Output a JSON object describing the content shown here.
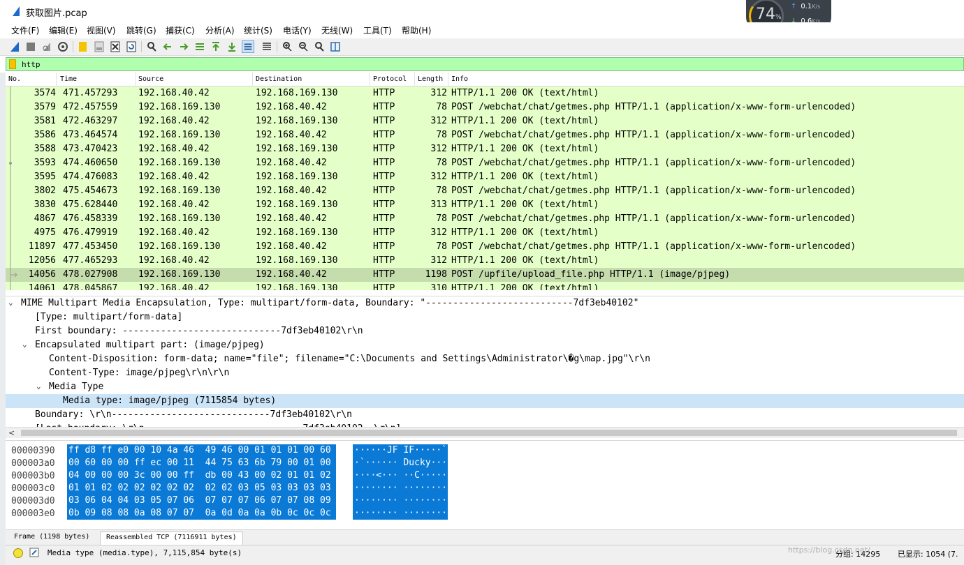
{
  "window": {
    "title": "获取图片.pcap"
  },
  "widget": {
    "cpu_percent": "74",
    "percent_sign": "%",
    "upload": "0.1",
    "download": "0.6",
    "unit": "K/s"
  },
  "menu": [
    "文件(F)",
    "编辑(E)",
    "视图(V)",
    "跳转(G)",
    "捕获(C)",
    "分析(A)",
    "统计(S)",
    "电话(Y)",
    "无线(W)",
    "工具(T)",
    "帮助(H)"
  ],
  "toolbar": [
    "shark-fin-start-icon",
    "stop-square-icon",
    "restart-fin-icon",
    "capture-options-gear-icon",
    "open-folder-icon",
    "file-save-icon",
    "file-close-icon",
    "reload-icon",
    "find-icon",
    "go-back-icon",
    "go-forward-icon",
    "go-to-packet-icon",
    "go-first-icon",
    "go-last-icon",
    "auto-scroll-icon",
    "colorize-icon",
    "zoom-in-icon",
    "zoom-out-icon",
    "zoom-normal-icon",
    "resize-columns-icon"
  ],
  "filter": {
    "value": "http"
  },
  "packet_list": {
    "columns": [
      "No.",
      "Time",
      "Source",
      "Destination",
      "Protocol",
      "Length",
      "Info"
    ],
    "rows": [
      {
        "no": "3574",
        "time": "471.457293",
        "src": "192.168.40.42",
        "dst": "192.168.169.130",
        "proto": "HTTP",
        "len": "312",
        "info": "HTTP/1.1 200 OK  (text/html)"
      },
      {
        "no": "3579",
        "time": "472.457559",
        "src": "192.168.169.130",
        "dst": "192.168.40.42",
        "proto": "HTTP",
        "len": "78",
        "info": "POST /webchat/chat/getmes.php HTTP/1.1  (application/x-www-form-urlencoded)"
      },
      {
        "no": "3581",
        "time": "472.463297",
        "src": "192.168.40.42",
        "dst": "192.168.169.130",
        "proto": "HTTP",
        "len": "312",
        "info": "HTTP/1.1 200 OK  (text/html)"
      },
      {
        "no": "3586",
        "time": "473.464574",
        "src": "192.168.169.130",
        "dst": "192.168.40.42",
        "proto": "HTTP",
        "len": "78",
        "info": "POST /webchat/chat/getmes.php HTTP/1.1  (application/x-www-form-urlencoded)"
      },
      {
        "no": "3588",
        "time": "473.470423",
        "src": "192.168.40.42",
        "dst": "192.168.169.130",
        "proto": "HTTP",
        "len": "312",
        "info": "HTTP/1.1 200 OK  (text/html)"
      },
      {
        "no": "3593",
        "time": "474.460650",
        "src": "192.168.169.130",
        "dst": "192.168.40.42",
        "proto": "HTTP",
        "len": "78",
        "info": "POST /webchat/chat/getmes.php HTTP/1.1  (application/x-www-form-urlencoded)"
      },
      {
        "no": "3595",
        "time": "474.476083",
        "src": "192.168.40.42",
        "dst": "192.168.169.130",
        "proto": "HTTP",
        "len": "312",
        "info": "HTTP/1.1 200 OK  (text/html)"
      },
      {
        "no": "3802",
        "time": "475.454673",
        "src": "192.168.169.130",
        "dst": "192.168.40.42",
        "proto": "HTTP",
        "len": "78",
        "info": "POST /webchat/chat/getmes.php HTTP/1.1  (application/x-www-form-urlencoded)"
      },
      {
        "no": "3830",
        "time": "475.628440",
        "src": "192.168.40.42",
        "dst": "192.168.169.130",
        "proto": "HTTP",
        "len": "313",
        "info": "HTTP/1.1 200 OK  (text/html)"
      },
      {
        "no": "4867",
        "time": "476.458339",
        "src": "192.168.169.130",
        "dst": "192.168.40.42",
        "proto": "HTTP",
        "len": "78",
        "info": "POST /webchat/chat/getmes.php HTTP/1.1  (application/x-www-form-urlencoded)"
      },
      {
        "no": "4975",
        "time": "476.479919",
        "src": "192.168.40.42",
        "dst": "192.168.169.130",
        "proto": "HTTP",
        "len": "312",
        "info": "HTTP/1.1 200 OK  (text/html)"
      },
      {
        "no": "11897",
        "time": "477.453450",
        "src": "192.168.169.130",
        "dst": "192.168.40.42",
        "proto": "HTTP",
        "len": "78",
        "info": "POST /webchat/chat/getmes.php HTTP/1.1  (application/x-www-form-urlencoded)"
      },
      {
        "no": "12056",
        "time": "477.465293",
        "src": "192.168.40.42",
        "dst": "192.168.169.130",
        "proto": "HTTP",
        "len": "312",
        "info": "HTTP/1.1 200 OK  (text/html)"
      },
      {
        "no": "14056",
        "time": "478.027908",
        "src": "192.168.169.130",
        "dst": "192.168.40.42",
        "proto": "HTTP",
        "len": "1198",
        "info": "POST /upfile/upload_file.php HTTP/1.1  (image/pjpeg)",
        "selected": true
      },
      {
        "no": "14061",
        "time": "478.045867",
        "src": "192.168.40.42",
        "dst": "192.168.169.130",
        "proto": "HTTP",
        "len": "310",
        "info": "HTTP/1.1 200 OK  (text/html)"
      }
    ]
  },
  "details": [
    {
      "text": "MIME Multipart Media Encapsulation, Type: multipart/form-data, Boundary: \"---------------------------7df3eb40102\"",
      "caret": "⌄"
    },
    {
      "text": "[Type: multipart/form-data]"
    },
    {
      "text": "First boundary: -----------------------------7df3eb40102\\r\\n"
    },
    {
      "text": "Encapsulated multipart part:  (image/pjpeg)",
      "caret": "⌄"
    },
    {
      "text": "Content-Disposition: form-data; name=\"file\"; filename=\"C:\\Documents and Settings\\Administrator\\�g\\map.jpg\"\\r\\n"
    },
    {
      "text": "Content-Type: image/pjpeg\\r\\n\\r\\n"
    },
    {
      "text": "Media Type",
      "caret": "⌄"
    },
    {
      "text": "Media type: image/pjpeg (7115854 bytes)",
      "highlight": true
    },
    {
      "text": "Boundary: \\r\\n-----------------------------7df3eb40102\\r\\n"
    },
    {
      "text": "[Last boundary: \\r\\n-----------------------------7df3eb40102--\\r\\n]"
    }
  ],
  "bytes": [
    {
      "offset": "00000390",
      "hex": "ff d8 ff e0 00 10 4a 46  49 46 00 01 01 01 00 60",
      "ascii": "······JF IF·····`"
    },
    {
      "offset": "000003a0",
      "hex": "00 60 00 00 ff ec 00 11  44 75 63 6b 79 00 01 00",
      "ascii": "·`······ Ducky···"
    },
    {
      "offset": "000003b0",
      "hex": "04 00 00 00 3c 00 00 ff  db 00 43 00 02 01 01 02",
      "ascii": "····<··· ··C·····"
    },
    {
      "offset": "000003c0",
      "hex": "01 01 02 02 02 02 02 02  02 02 03 05 03 03 03 03",
      "ascii": "········ ········"
    },
    {
      "offset": "000003d0",
      "hex": "03 06 04 04 03 05 07 06  07 07 07 06 07 07 08 09",
      "ascii": "········ ········"
    },
    {
      "offset": "000003e0",
      "hex": "0b 09 08 08 0a 08 07 07  0a 0d 0a 0a 0b 0c 0c 0c",
      "ascii": "········ ········"
    }
  ],
  "tabs": [
    "Frame (1198 bytes)",
    "Reassembled TCP (7116911 bytes)"
  ],
  "status": {
    "message": "Media type (media.type), 7,115,854 byte(s)",
    "packets": "分组: 14295",
    "displayed": "已显示: 1054 (7."
  },
  "watermark": "https://blog.csdn.net/..."
}
